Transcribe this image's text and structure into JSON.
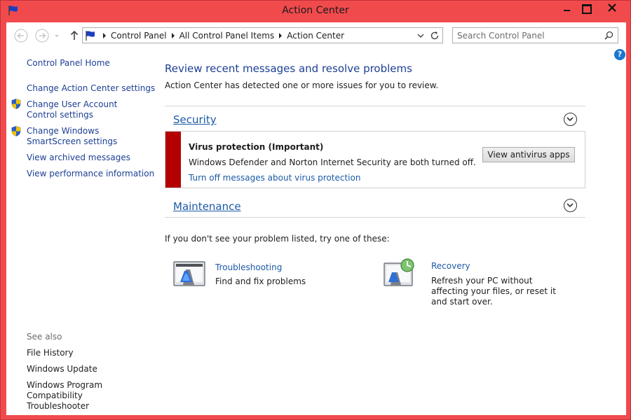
{
  "window": {
    "title": "Action Center",
    "accent": "#f14a4d"
  },
  "address": {
    "crumbs": [
      "Control Panel",
      "All Control Panel Items",
      "Action Center"
    ],
    "search_placeholder": "Search Control Panel"
  },
  "leftnav": {
    "home": "Control Panel Home",
    "items": [
      {
        "label": "Change Action Center settings",
        "shield": false
      },
      {
        "label": "Change User Account Control settings",
        "shield": true
      },
      {
        "label": "Change Windows SmartScreen settings",
        "shield": true
      },
      {
        "label": "View archived messages",
        "shield": false
      },
      {
        "label": "View performance information",
        "shield": false
      }
    ],
    "see_also_title": "See also",
    "see_also": [
      "File History",
      "Windows Update",
      "Windows Program Compatibility Troubleshooter"
    ]
  },
  "main": {
    "title": "Review recent messages and resolve problems",
    "subtitle": "Action Center has detected one or more issues for you to review.",
    "security": {
      "label": "Security",
      "alert": {
        "title": "Virus protection  (Important)",
        "text": "Windows Defender and Norton Internet Security are both turned off.",
        "link": "Turn off messages about virus protection",
        "button": "View antivirus apps",
        "color": "#b40000"
      }
    },
    "maintenance": {
      "label": "Maintenance"
    },
    "hint": "If you don't see your problem listed, try one of these:",
    "tools": [
      {
        "title": "Troubleshooting",
        "desc": "Find and fix problems",
        "icon": "troubleshooting-icon"
      },
      {
        "title": "Recovery",
        "desc": "Refresh your PC without affecting your files, or reset it and start over.",
        "icon": "recovery-icon"
      }
    ]
  }
}
